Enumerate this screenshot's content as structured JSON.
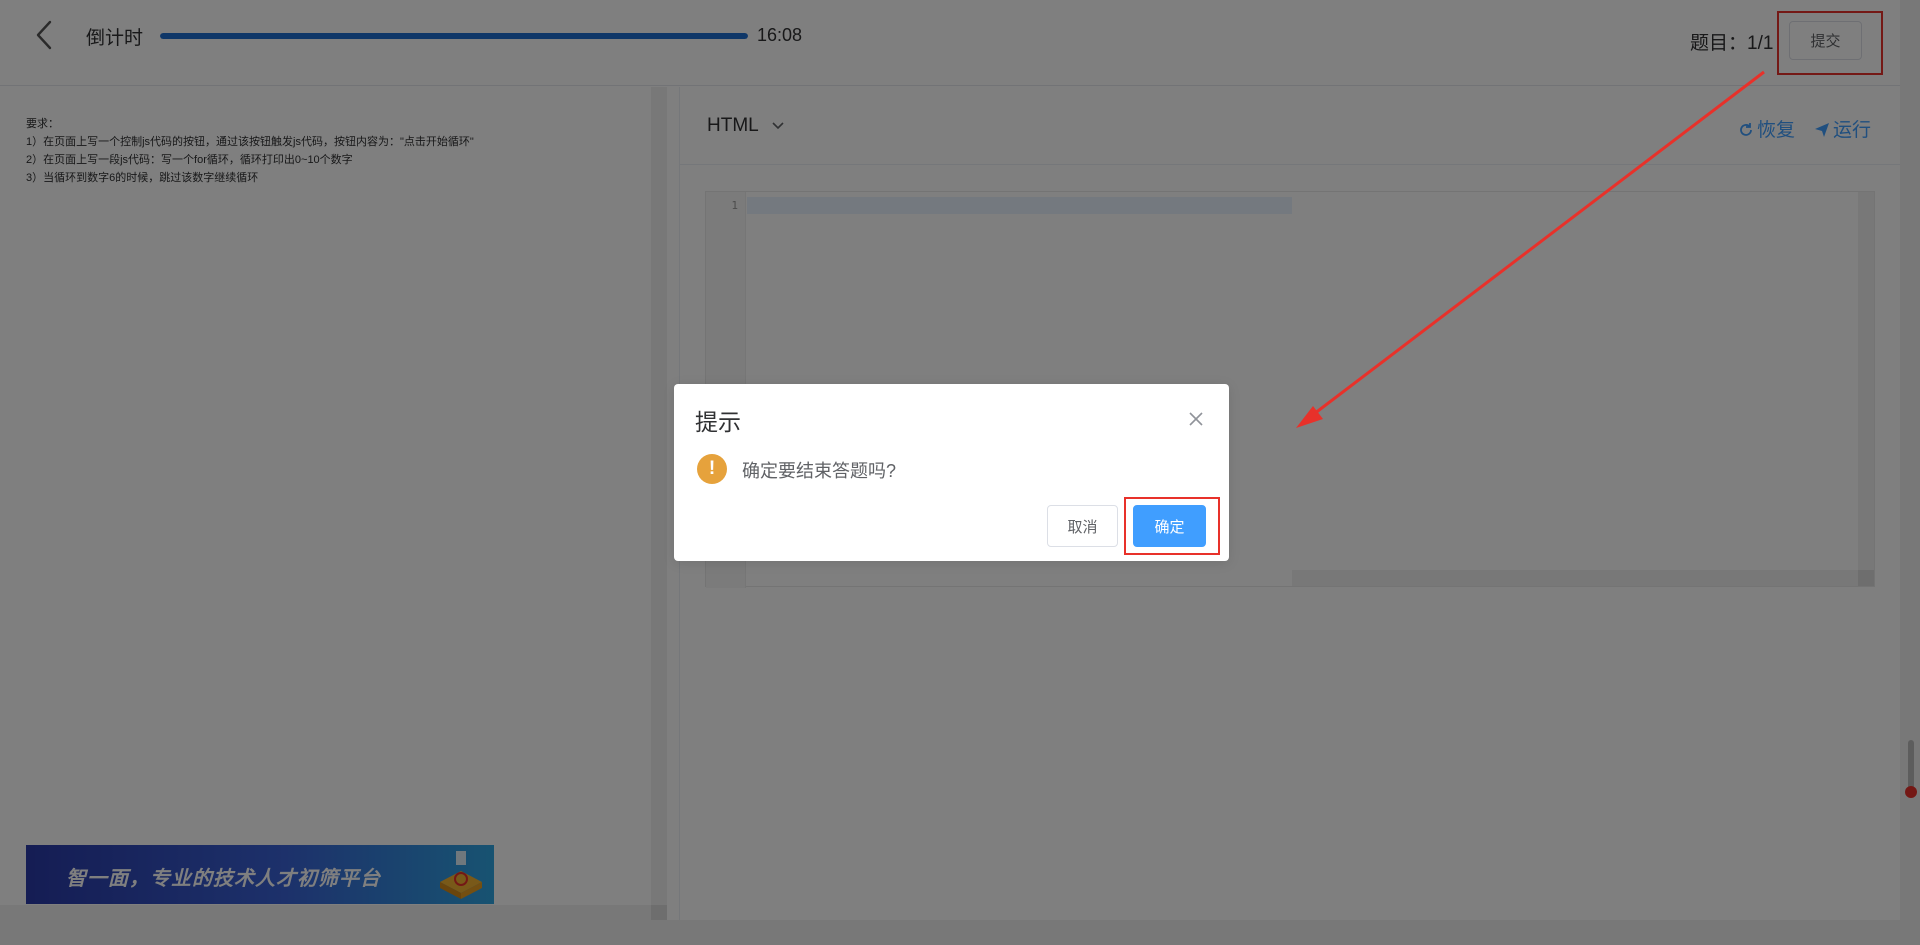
{
  "header": {
    "timer_label": "倒计时",
    "timer_value": "16:08",
    "timer_progress": 1.0,
    "question_counter": "题目：1/1",
    "submit_label": "提交"
  },
  "requirements": {
    "heading": "要求：",
    "items": [
      "1）在页面上写一个控制js代码的按钮，通过该按钮触发js代码，按钮内容为：\"点击开始循环\"",
      "2）在页面上写一段js代码：写一个for循环，循环打印出0~10个数字",
      "3）当循环到数字6的时候，跳过该数字继续循环"
    ]
  },
  "banner": {
    "text": "智一面，专业的技术人才初筛平台"
  },
  "editor": {
    "language": "HTML",
    "restore_label": "恢复",
    "run_label": "运行",
    "line_numbers": [
      "1"
    ],
    "content": ""
  },
  "dialog": {
    "title": "提示",
    "message": "确定要结束答题吗?",
    "cancel_label": "取消",
    "confirm_label": "确定"
  },
  "colors": {
    "accent": "#409eff",
    "progress": "#1f6fd1",
    "warning": "#e6a23c",
    "annotation": "#e8312a",
    "overlay": "rgba(0,0,0,0.5)"
  }
}
